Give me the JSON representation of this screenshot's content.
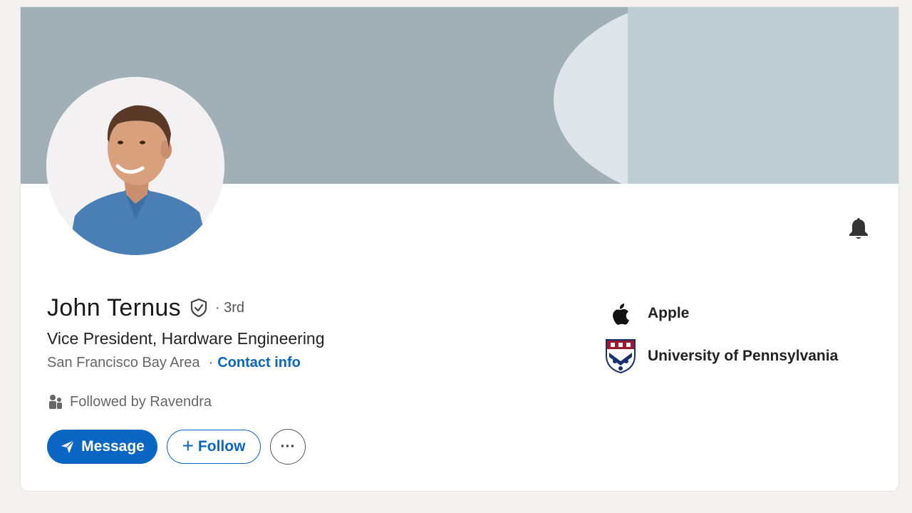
{
  "profile": {
    "name": "John Ternus",
    "degree": "· 3rd",
    "headline": "Vice President, Hardware Engineering",
    "location": "San Francisco Bay Area",
    "location_separator": "·",
    "contact_label": "Contact info",
    "followed_by": "Followed by Ravendra"
  },
  "actions": {
    "message_label": "Message",
    "follow_label": "Follow",
    "follow_icon": "+",
    "more_label": "···"
  },
  "organizations": {
    "company": "Apple",
    "company_icon": "apple-logo-icon",
    "school": "University of Pennsylvania",
    "school_icon": "upenn-shield-icon"
  },
  "colors": {
    "accent": "#0a66c2",
    "banner": "#a1afb6",
    "page_bg": "#f4f2ee"
  }
}
